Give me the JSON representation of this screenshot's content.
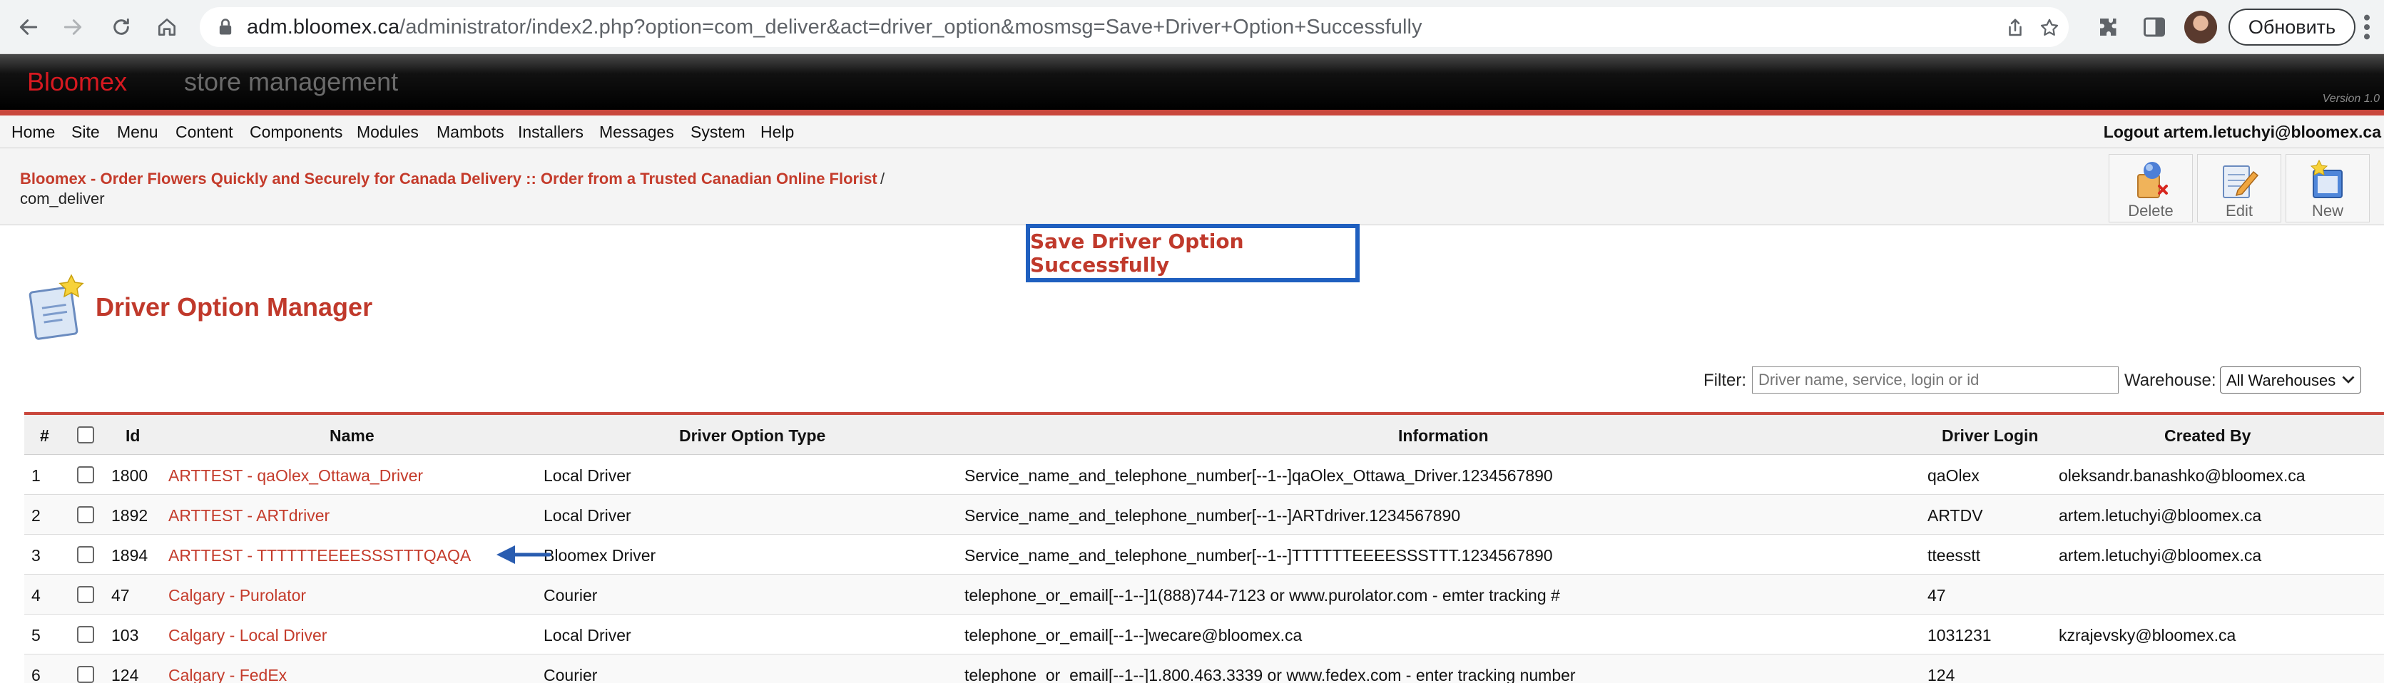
{
  "browser": {
    "url_host": "adm.bloomex.ca",
    "url_path": "/administrator/index2.php?option=com_deliver&act=driver_option&mosmsg=Save+Driver+Option+Successfully",
    "update_label": "Обновить"
  },
  "header": {
    "brand_red": "Bloomex",
    "brand_grey": "store management",
    "version": "Version 1.0"
  },
  "menu": {
    "items": [
      "Home",
      "Site",
      "Menu",
      "Content",
      "Components",
      "Modules",
      "Mambots",
      "Installers",
      "Messages",
      "System",
      "Help"
    ],
    "logout": "Logout artem.letuchyi@bloomex.ca"
  },
  "pathway": {
    "link": "Bloomex - Order Flowers Quickly and Securely for Canada Delivery :: Order from a Trusted Canadian Online Florist",
    "separator": "/",
    "current": "com_deliver"
  },
  "toolbar": {
    "delete_label": "Delete",
    "edit_label": "Edit",
    "new_label": "New"
  },
  "message": "Save Driver Option Successfully",
  "page_title": "Driver Option Manager",
  "filter": {
    "label": "Filter:",
    "placeholder": "Driver name, service, login or id",
    "warehouse_label": "Warehouse:",
    "warehouse_value": "All Warehouses"
  },
  "table": {
    "headers": {
      "num": "#",
      "id": "Id",
      "name": "Name",
      "type": "Driver Option Type",
      "info": "Information",
      "login": "Driver Login",
      "created": "Created By"
    },
    "rows": [
      {
        "num": "1",
        "id": "1800",
        "name": "ARTTEST - qaOlex_Ottawa_Driver",
        "type": "Local Driver",
        "info": "Service_name_and_telephone_number[--1--]qaOlex_Ottawa_Driver.1234567890",
        "login": "qaOlex",
        "created": "oleksandr.banashko@bloomex.ca"
      },
      {
        "num": "2",
        "id": "1892",
        "name": "ARTTEST - ARTdriver",
        "type": "Local Driver",
        "info": "Service_name_and_telephone_number[--1--]ARTdriver.1234567890",
        "login": "ARTDV",
        "created": "artem.letuchyi@bloomex.ca"
      },
      {
        "num": "3",
        "id": "1894",
        "name": "ARTTEST - TTTTTTEEEESSSTTTQAQA",
        "type": "Bloomex Driver",
        "info": "Service_name_and_telephone_number[--1--]TTTTTTEEEESSSTTT.1234567890",
        "login": "tteesstt",
        "created": "artem.letuchyi@bloomex.ca"
      },
      {
        "num": "4",
        "id": "47",
        "name": "Calgary - Purolator",
        "type": "Courier",
        "info": "telephone_or_email[--1--]1(888)744-7123 or www.purolator.com - emter tracking #",
        "login": "47",
        "created": ""
      },
      {
        "num": "5",
        "id": "103",
        "name": "Calgary - Local Driver",
        "type": "Local Driver",
        "info": "telephone_or_email[--1--]wecare@bloomex.ca",
        "login": "1031231",
        "created": "kzrajevsky@bloomex.ca"
      },
      {
        "num": "6",
        "id": "124",
        "name": "Calgary - FedEx",
        "type": "Courier",
        "info": "telephone_or_email[--1--]1.800.463.3339 or www.fedex.com - enter tracking number",
        "login": "124",
        "created": ""
      }
    ]
  },
  "colors": {
    "accent_red": "#c0392b",
    "message_border": "#1f5fbf"
  }
}
